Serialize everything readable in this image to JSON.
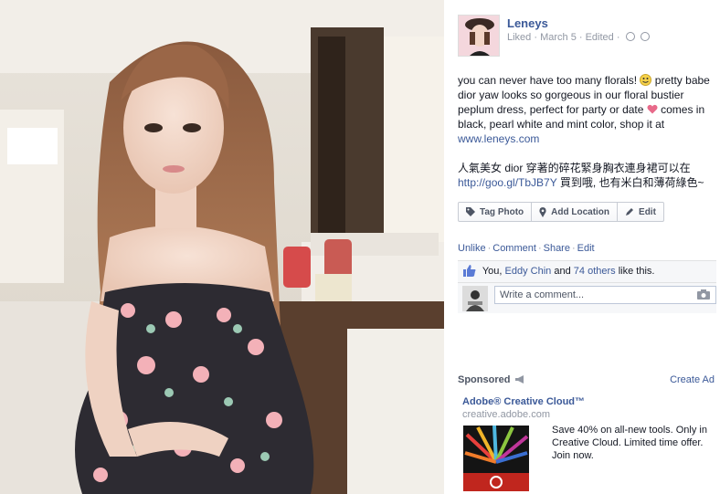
{
  "post": {
    "author": "Leneys",
    "meta": "Liked · March 5 · Edited ·",
    "message_line1_a": "you can never have too many florals!",
    "message_line1_b": "pretty babe dior yaw looks so gorgeous in our floral bustier peplum dress, perfect for party or date",
    "message_line1_c": "comes in black, pearl white and mint color, shop it at",
    "message_link": "www.leneys.com",
    "message_cn": "人氣美女 dior 穿著的碎花緊身胸衣連身裙可以在",
    "message_cn_link": "http://goo.gl/TbJB7Y",
    "message_cn_tail": "買到哦, 也有米白和薄荷綠色~"
  },
  "actions": {
    "tag_photo": "Tag Photo",
    "add_location": "Add Location",
    "edit": "Edit"
  },
  "ufi": {
    "unlike": "Unlike",
    "comment": "Comment",
    "share": "Share",
    "edit": "Edit",
    "likes_you": "You,",
    "likes_person": "Eddy Chin",
    "likes_and": "and",
    "likes_others": "74 others",
    "likes_tail": "like this.",
    "comment_placeholder": "Write a comment..."
  },
  "sidebar": {
    "sponsored_label": "Sponsored",
    "create_ad": "Create Ad",
    "ad_title": "Adobe® Creative Cloud™",
    "ad_domain": "creative.adobe.com",
    "ad_body": "Save 40% on all-new tools. Only in Creative Cloud. Limited time offer. Join now."
  },
  "colors": {
    "link": "#3b5998",
    "muted": "#9197a3",
    "heart": "#e0245e"
  }
}
